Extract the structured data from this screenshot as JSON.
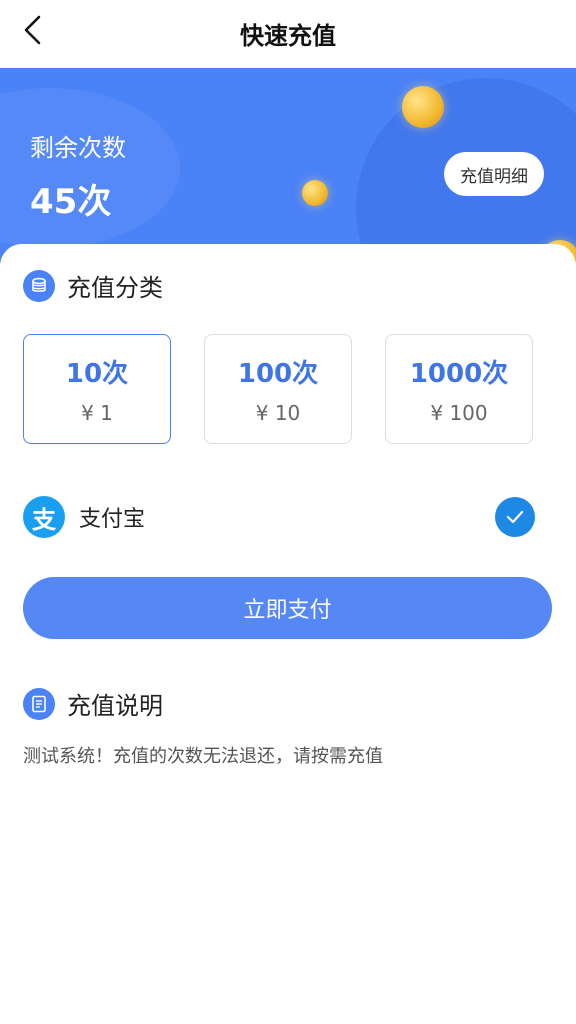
{
  "header": {
    "title": "快速充值"
  },
  "balance": {
    "label": "剩余次数",
    "value": "45次",
    "detail_button": "充值明细"
  },
  "recharge": {
    "section_title": "充值分类",
    "options": [
      {
        "count": "10次",
        "price": "¥ 1",
        "selected": true
      },
      {
        "count": "100次",
        "price": "¥ 10",
        "selected": false
      },
      {
        "count": "1000次",
        "price": "¥ 100",
        "selected": false
      }
    ]
  },
  "payment": {
    "method_label": "支付宝",
    "method_icon_text": "支",
    "selected": true,
    "submit_label": "立即支付"
  },
  "notes": {
    "section_title": "充值说明",
    "text": "测试系统！充值的次数无法退还，请按需充值"
  },
  "colors": {
    "primary": "#4a82f7",
    "pay_button": "#5588f5",
    "alipay": "#1a9ff0",
    "check": "#1e88e5"
  },
  "icons": {
    "back": "chevron-left-icon",
    "category": "coin-stack-icon",
    "notes": "document-icon",
    "check": "check-circle-icon"
  }
}
